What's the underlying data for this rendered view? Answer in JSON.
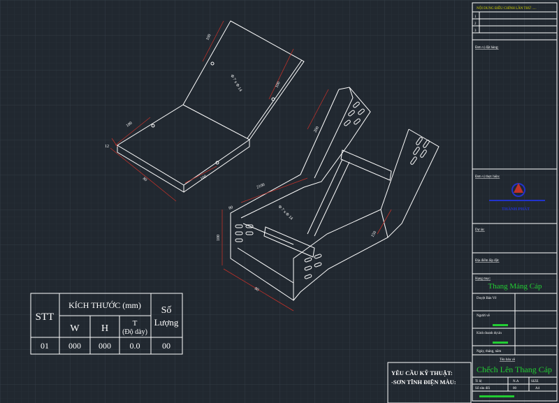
{
  "colors": {
    "background": "#212830",
    "grid_minor": "#2b333c",
    "grid_major": "#354049",
    "line": "#ffffff",
    "dimension": "#c0312a",
    "accent_green": "#22cc33",
    "title_yellow": "#d4d400",
    "company_blue": "#2233cc"
  },
  "dimensions": {
    "top_plate": [
      "100",
      "Φ 7 x Φ 14",
      "100",
      "100",
      "100",
      "12",
      "80"
    ],
    "ladder": [
      "200",
      "2100",
      "Φ 7 x Φ 14",
      "100",
      "80",
      "80",
      "150"
    ]
  },
  "quantity_table": {
    "stt_header": "STT",
    "size_header": "KÍCH THƯỚC (mm)",
    "qty_header": "Số Lượng",
    "w_header": "W",
    "h_header": "H",
    "t_header": "T",
    "t_sub": "(Độ dày)",
    "row": {
      "stt": "01",
      "w": "000",
      "h": "000",
      "t": "0.0",
      "qty": "00"
    }
  },
  "requirements": {
    "line1": "YÊU CẦU KỸ THUẬT:",
    "line2": "-SƠN TĨNH ĐIỆN MÀU:"
  },
  "title_block": {
    "revision_header": "NỘI DUNG ĐIỀU CHỈNH LẦN THỨ .....",
    "revision_rows": [
      "1",
      "2",
      "3"
    ],
    "client_label": "Đơn vị đặt hàng:",
    "contractor_label": "Đơn vị thực hiện:",
    "company_name": "THÀNH PHÁT",
    "project_label": "Dự án:",
    "location_label": "Địa điểm lắp đặt:",
    "item_label": "Hạng mục:",
    "item_value": "Thang Máng Cáp",
    "approved_label": "Duyệt Bản Vẽ",
    "drafter_label": "Người vẽ",
    "sales_label": "Kinh doanh dự án",
    "date_label": "Ngày, tháng, năm",
    "drawing_name_label": "Tên bản vẽ",
    "drawing_name": "Chếch Lên Thang Cáp",
    "scale_label": "Tỉ lệ",
    "scale_value": "N.A",
    "size_label": "SIZE",
    "sheet_label": "Số sửa đổi",
    "sheet_value": "00",
    "size_value": "A4"
  }
}
